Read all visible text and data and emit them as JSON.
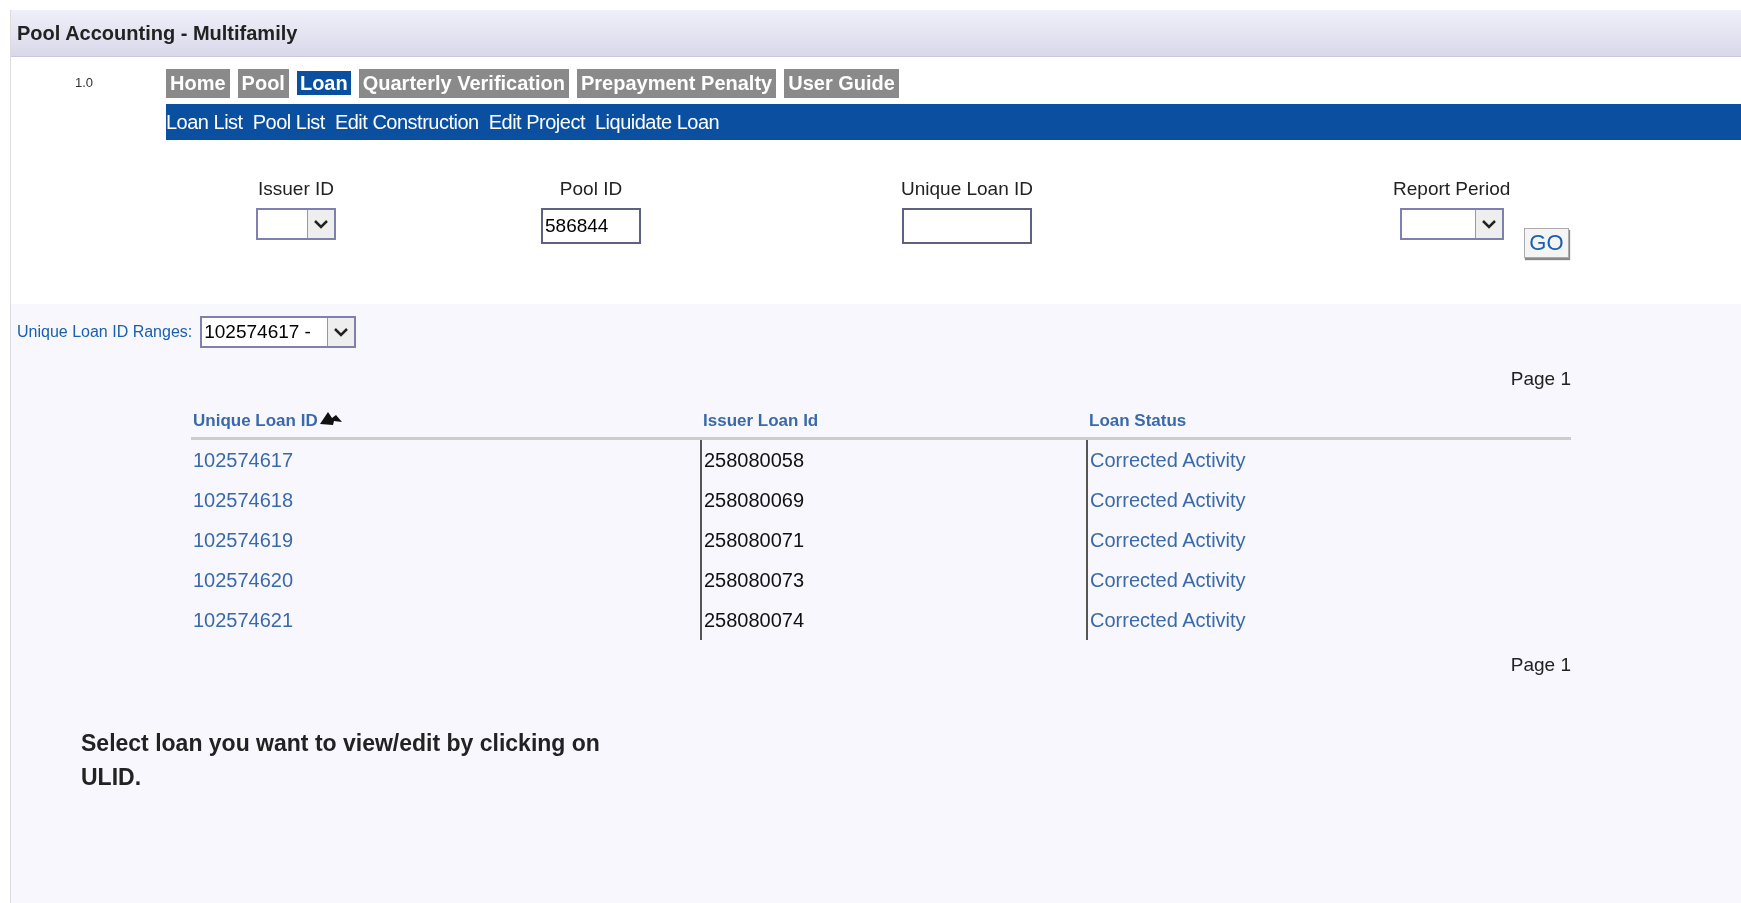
{
  "window": {
    "title": "Pool Accounting - Multifamily"
  },
  "version": "1.0",
  "tabs": [
    {
      "label": "Home",
      "selected": false
    },
    {
      "label": "Pool",
      "selected": false
    },
    {
      "label": "Loan",
      "selected": true
    },
    {
      "label": "Quarterly Verification",
      "selected": false
    },
    {
      "label": "Prepayment Penalty",
      "selected": false
    },
    {
      "label": "User Guide",
      "selected": false
    }
  ],
  "subnav": [
    "Loan List",
    "Pool List",
    "Edit Construction",
    "Edit Project",
    "Liquidate Loan"
  ],
  "filters": [
    {
      "label": "Issuer ID",
      "kind": "select"
    },
    {
      "label": "Pool ID",
      "kind": "text",
      "value": "586844"
    },
    {
      "label": "Unique Loan ID",
      "kind": "text"
    },
    {
      "label": "Report Period",
      "kind": "select"
    }
  ],
  "go_button": "GO",
  "ranges": {
    "label": "Unique Loan ID Ranges:",
    "value": "102574617 -"
  },
  "page_top": "Page 1",
  "table": {
    "columns": [
      "Unique Loan ID",
      "Issuer Loan Id",
      "Loan Status"
    ],
    "rows": [
      [
        "102574617",
        "258080058",
        "Corrected Activity"
      ],
      [
        "102574618",
        "258080069",
        "Corrected Activity"
      ],
      [
        "102574619",
        "258080071",
        "Corrected Activity"
      ],
      [
        "102574620",
        "258080073",
        "Corrected Activity"
      ],
      [
        "102574621",
        "258080074",
        "Corrected Activity"
      ]
    ]
  },
  "page_bottom": "Page 1",
  "instruction": "Select loan you want to view/edit by clicking on ULID."
}
